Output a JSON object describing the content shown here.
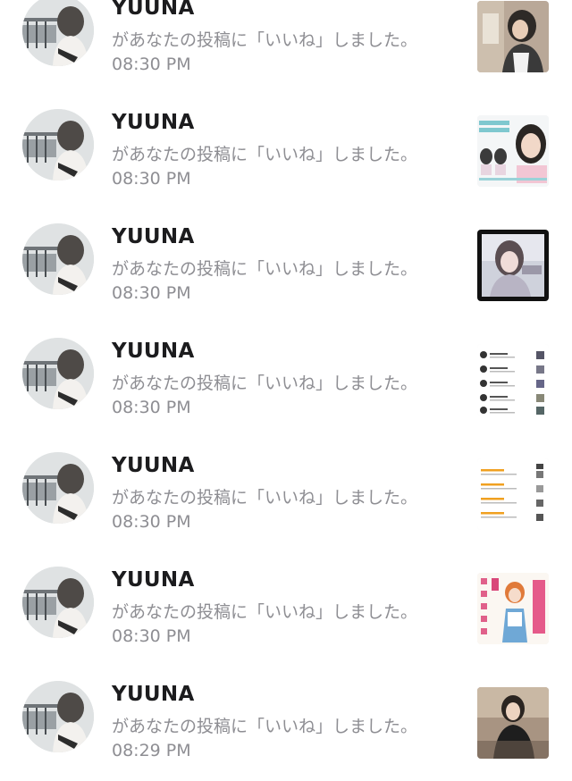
{
  "notifications": [
    {
      "user": "YUUNA",
      "message": "があなたの投稿に「いいね」しました。",
      "time": "08:30 PM",
      "post_thumbnail": "photo-thumbnail"
    },
    {
      "user": "YUUNA",
      "message": "があなたの投稿に「いいね」しました。",
      "time": "08:30 PM",
      "post_thumbnail": "photo-card-fair-thumbnail"
    },
    {
      "user": "YUUNA",
      "message": "があなたの投稿に「いいね」しました。",
      "time": "08:30 PM",
      "post_thumbnail": "dark-photo-thumbnail"
    },
    {
      "user": "YUUNA",
      "message": "があなたの投稿に「いいね」しました。",
      "time": "08:30 PM",
      "post_thumbnail": "list-screenshot-thumbnail"
    },
    {
      "user": "YUUNA",
      "message": "があなたの投稿に「いいね」しました。",
      "time": "08:30 PM",
      "post_thumbnail": "list-screenshot-thumbnail"
    },
    {
      "user": "YUUNA",
      "message": "があなたの投稿に「いいね」しました。",
      "time": "08:30 PM",
      "post_thumbnail": "manga-cover-thumbnail"
    },
    {
      "user": "YUUNA",
      "message": "があなたの投稿に「いいね」しました。",
      "time": "08:29 PM",
      "post_thumbnail": "photo-thumbnail"
    }
  ],
  "colors": {
    "name": "#1c1c1e",
    "secondary_text": "#8e8e93",
    "background": "#ffffff"
  }
}
